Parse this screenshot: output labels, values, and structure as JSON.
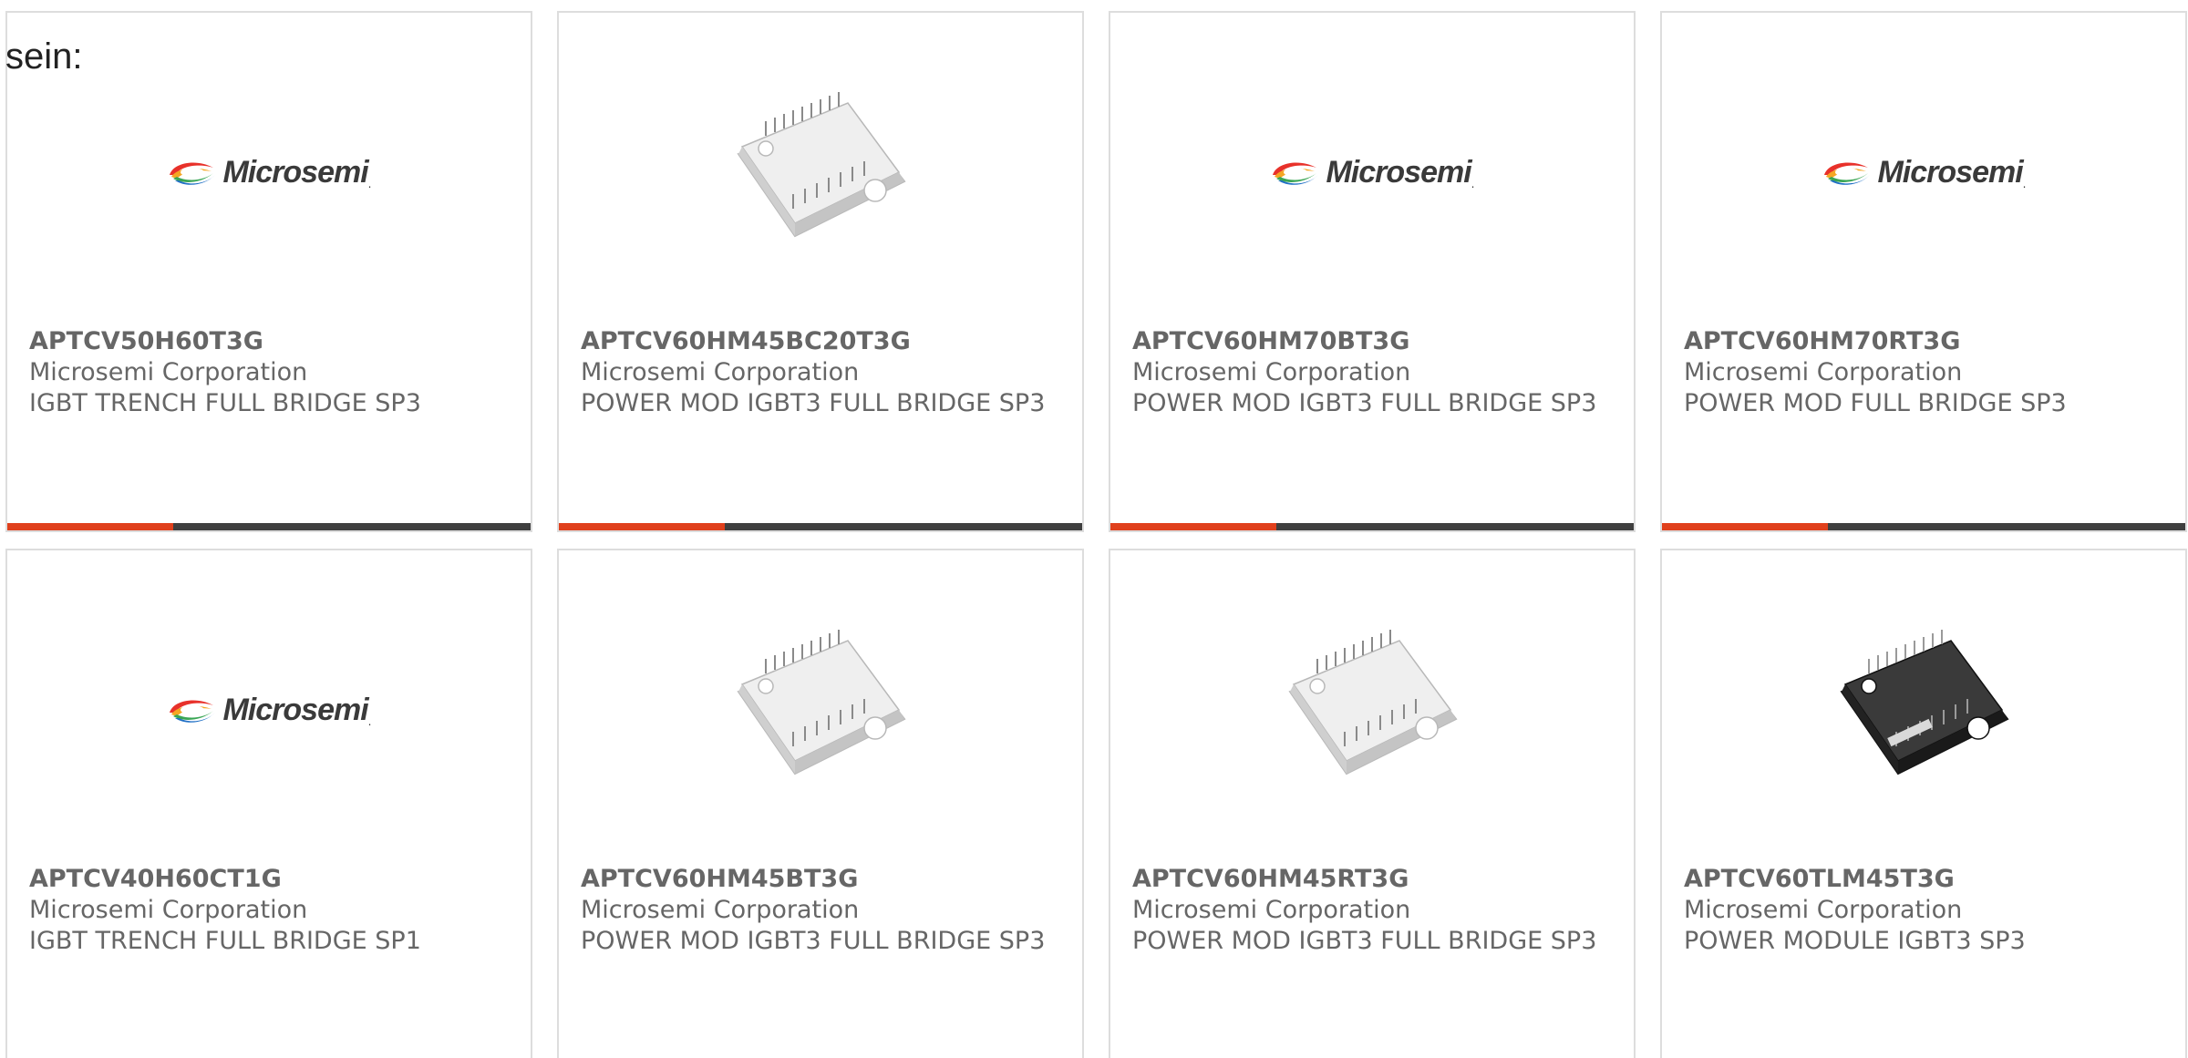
{
  "intro_text": "sein:",
  "logo": {
    "brand_text": "Microsemi",
    "trademark": "."
  },
  "colors": {
    "accent_bar": "#e0401c",
    "bar": "#3f3f3f",
    "text": "#666666",
    "border": "#dddddd"
  },
  "products": [
    {
      "part_number": "APTCV50H60T3G",
      "manufacturer": "Microsemi Corporation",
      "description": "IGBT TRENCH FULL BRIDGE SP3",
      "image": "microsemi-logo"
    },
    {
      "part_number": "APTCV60HM45BC20T3G",
      "manufacturer": "Microsemi Corporation",
      "description": "POWER MOD IGBT3 FULL BRIDGE SP3",
      "image": "white-power-module"
    },
    {
      "part_number": "APTCV60HM70BT3G",
      "manufacturer": "Microsemi Corporation",
      "description": "POWER MOD IGBT3 FULL BRIDGE SP3",
      "image": "microsemi-logo"
    },
    {
      "part_number": "APTCV60HM70RT3G",
      "manufacturer": "Microsemi Corporation",
      "description": "POWER MOD FULL BRIDGE SP3",
      "image": "microsemi-logo"
    },
    {
      "part_number": "APTCV40H60CT1G",
      "manufacturer": "Microsemi Corporation",
      "description": "IGBT TRENCH FULL BRIDGE SP1",
      "image": "microsemi-logo"
    },
    {
      "part_number": "APTCV60HM45BT3G",
      "manufacturer": "Microsemi Corporation",
      "description": "POWER MOD IGBT3 FULL BRIDGE SP3",
      "image": "white-power-module"
    },
    {
      "part_number": "APTCV60HM45RT3G",
      "manufacturer": "Microsemi Corporation",
      "description": "POWER MOD IGBT3 FULL BRIDGE SP3",
      "image": "white-power-module"
    },
    {
      "part_number": "APTCV60TLM45T3G",
      "manufacturer": "Microsemi Corporation",
      "description": "POWER MODULE IGBT3 SP3",
      "image": "black-power-module"
    }
  ]
}
